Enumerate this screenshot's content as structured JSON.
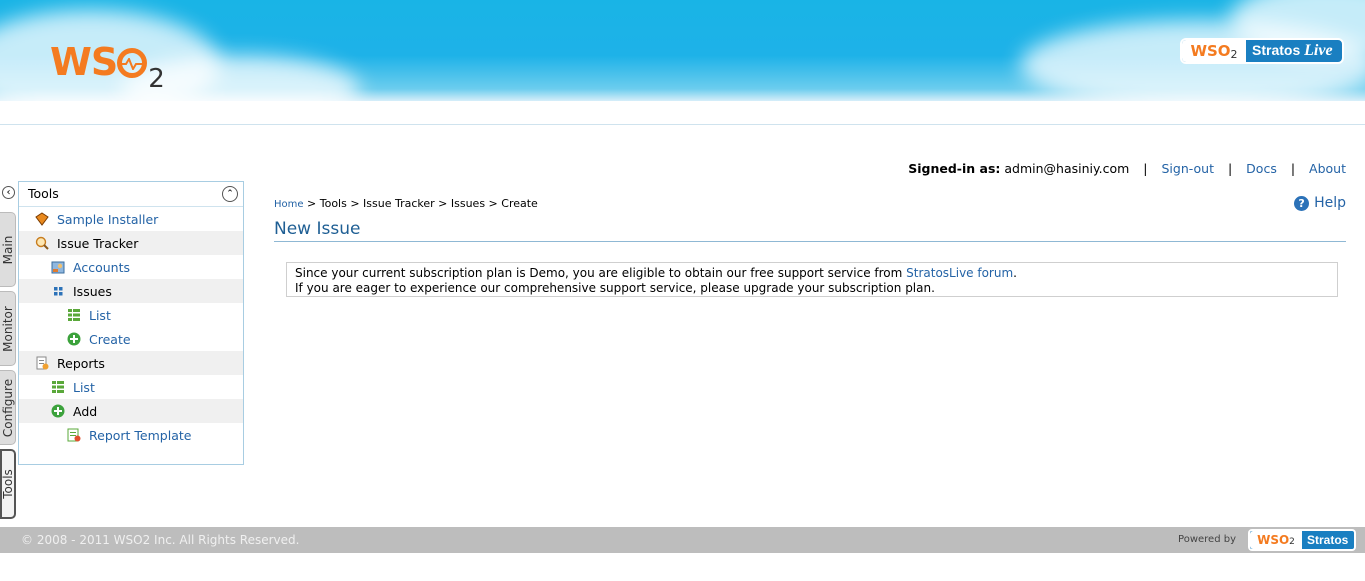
{
  "header": {
    "logo_text": "WSO2",
    "badge_prefix": "WSO2",
    "badge_product": "Stratos",
    "badge_suffix": "Live"
  },
  "toplinks": {
    "signed_in_label": "Signed-in as:",
    "user": "admin@hasiniy.com",
    "signout": "Sign-out",
    "docs": "Docs",
    "about": "About",
    "separator": "|"
  },
  "vertical_tabs": [
    "Main",
    "Monitor",
    "Configure",
    "Tools"
  ],
  "sidebar": {
    "heading": "Tools",
    "items": [
      {
        "label": "Sample Installer",
        "icon": "installer-icon",
        "link": true
      },
      {
        "label": "Issue Tracker",
        "icon": "issue-tracker-icon",
        "link": false
      },
      {
        "label": "Accounts",
        "icon": "accounts-icon",
        "link": true
      },
      {
        "label": "Issues",
        "icon": "grid-icon",
        "link": false
      },
      {
        "label": "List",
        "icon": "list-icon",
        "link": true
      },
      {
        "label": "Create",
        "icon": "add-icon",
        "link": true
      },
      {
        "label": "Reports",
        "icon": "reports-icon",
        "link": false
      },
      {
        "label": "List",
        "icon": "list-icon",
        "link": true
      },
      {
        "label": "Add",
        "icon": "add-icon",
        "link": false
      },
      {
        "label": "Report Template",
        "icon": "report-template-icon",
        "link": true
      }
    ]
  },
  "breadcrumb": {
    "home": "Home",
    "rest": " > Tools > Issue Tracker > Issues > Create"
  },
  "help_label": "Help",
  "page_title": "New Issue",
  "notice": {
    "line1_prefix": "Since your current subscription plan is Demo, you are eligible to obtain our free support service from ",
    "line1_link": "StratosLive forum",
    "line1_suffix": ".",
    "line2": "If you are eager to experience our comprehensive support service, please upgrade your subscription plan."
  },
  "footer": {
    "copyright": "© 2008 - 2011 WSO2 Inc. All Rights Reserved.",
    "powered_by": "Powered by",
    "badge_prefix": "WSO2",
    "badge_product": "Stratos"
  },
  "colors": {
    "link": "#2463a6",
    "header_sky": "#19b4e6",
    "brand_orange": "#f47b20",
    "footer_bg": "#bdbdbd"
  }
}
